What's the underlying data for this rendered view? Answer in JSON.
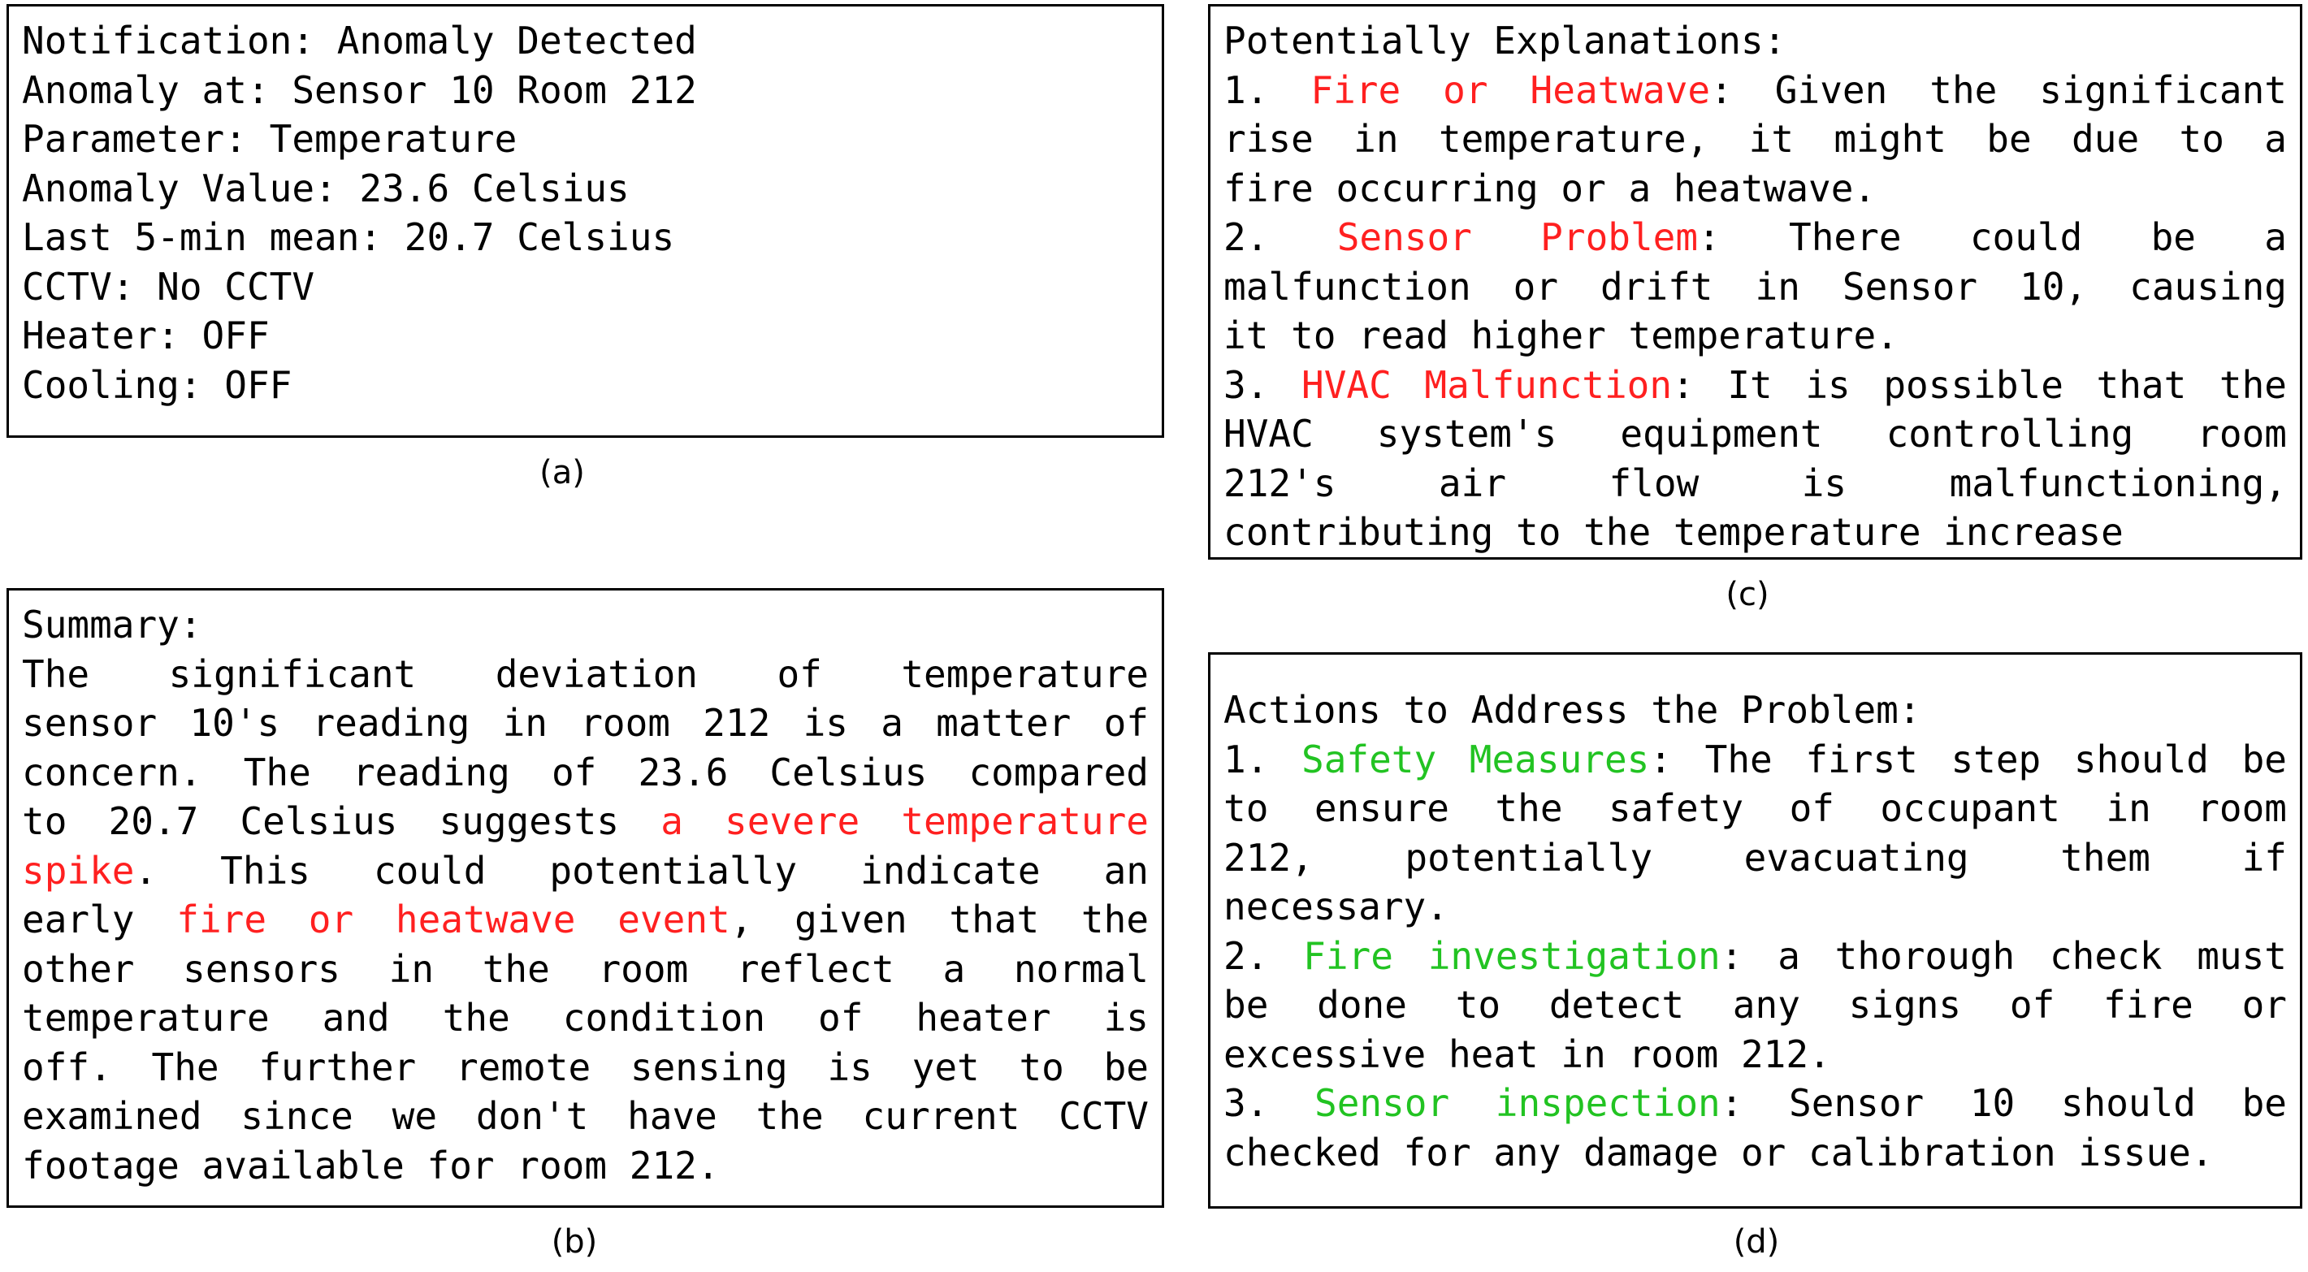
{
  "notification": {
    "lines": [
      "Notification: Anomaly Detected",
      "Anomaly at: Sensor 10 Room 212",
      "Parameter: Temperature",
      "Anomaly Value: 23.6 Celsius",
      "Last 5-min mean: 20.7 Celsius",
      "CCTV: No CCTV",
      "Heater: OFF",
      "Cooling: OFF"
    ],
    "caption": "(a)"
  },
  "summary": {
    "heading": "Summary:",
    "l1": "The significant deviation of temperature",
    "l2": "sensor 10's reading in room 212 is a matter of",
    "l3": "concern. The reading of 23.6 Celsius compared",
    "l4_pre": "to 20.7 Celsius suggests",
    "l4_hl": "a severe temperature",
    "l5_hl": "spike",
    "l5_post": ". This could potentially indicate an",
    "l6_pre": "early",
    "l6_hl": "fire or heatwave event",
    "l6_post": ", given that the",
    "l7": "other sensors in the room reflect a normal",
    "l8": "temperature and the condition of heater is",
    "l9": "off. The further remote sensing is yet to be",
    "l10": "examined since we don't have the current CCTV",
    "l11": "footage available for room 212.",
    "caption": "(b)"
  },
  "explanations": {
    "heading": "Potentially Explanations:",
    "e1_num": "1.",
    "e1_title": "Fire or Heatwave",
    "e1_a": ": Given the significant",
    "e1_b": "rise in temperature, it might be due to a",
    "e1_c": "fire occurring or a heatwave.",
    "e2_num": "2.",
    "e2_title": "Sensor Problem",
    "e2_a": ": There could be a",
    "e2_b": "malfunction or drift in Sensor 10, causing",
    "e2_c": "it to read higher temperature.",
    "e3_num": "3.",
    "e3_title": "HVAC Malfunction",
    "e3_a": ": It is possible that the",
    "e3_b": "HVAC system's equipment controlling room",
    "e3_c": "212's air flow is malfunctioning,",
    "e3_d": "contributing to the temperature increase",
    "caption": "(c)"
  },
  "actions": {
    "heading": "Actions to Address the Problem:",
    "a1_num": "1.",
    "a1_title": "Safety Measures",
    "a1_a": ": The first step should be",
    "a1_b": "to ensure the safety of occupant in room",
    "a1_c": "212, potentially evacuating them if",
    "a1_d": "necessary.",
    "a2_num": "2.",
    "a2_title": "Fire investigation",
    "a2_a": ": a thorough check must",
    "a2_b": "be done to detect any signs of fire or",
    "a2_c": "excessive heat in room 212.",
    "a3_num": "3.",
    "a3_title": "Sensor inspection",
    "a3_a": ": Sensor 10 should be",
    "a3_b": "checked for any damage or calibration issue.",
    "caption": "(d)"
  },
  "colors": {
    "highlight_red": "#ff2020",
    "highlight_green": "#22c322"
  }
}
